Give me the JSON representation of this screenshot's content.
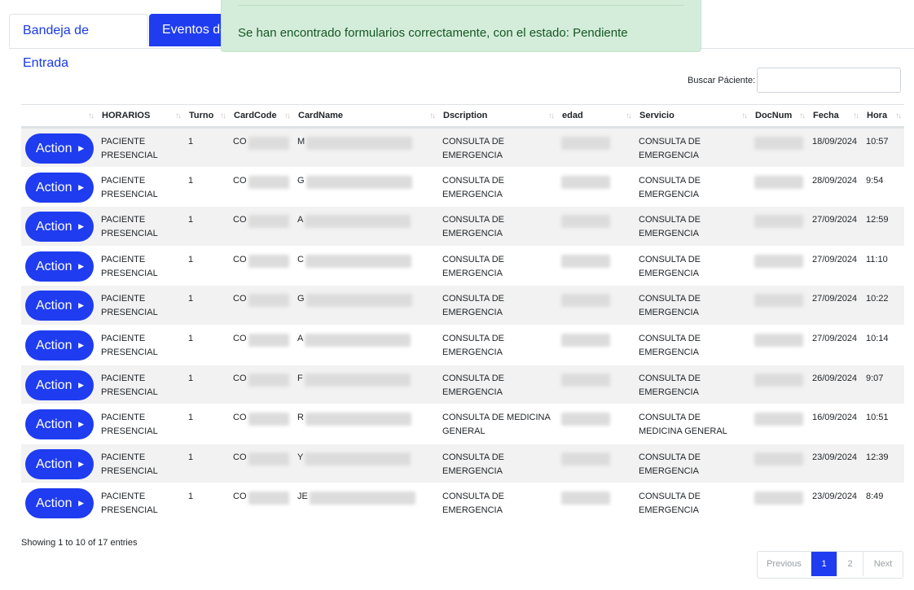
{
  "tabs": {
    "inbox": "Bandeja de Entrada",
    "events": "Eventos de"
  },
  "toast": {
    "message": "Se han encontrado formularios correctamente, con el estado: Pendiente"
  },
  "search": {
    "label": "Buscar Páciente:",
    "value": ""
  },
  "table": {
    "headers": [
      "",
      "HORARIOS",
      "Turno",
      "CardCode",
      "CardName",
      "Dscription",
      "edad",
      "Servicio",
      "DocNum",
      "Fecha",
      "Hora"
    ],
    "action_label": "Action",
    "rows": [
      {
        "horarios": "PACIENTE PRESENCIAL",
        "turno": "1",
        "cardcode": "CO",
        "cardname": "M",
        "dscription": "CONSULTA DE EMERGENCIA",
        "servicio": "CONSULTA DE EMERGENCIA",
        "fecha": "18/09/2024",
        "hora": "10:57"
      },
      {
        "horarios": "PACIENTE PRESENCIAL",
        "turno": "1",
        "cardcode": "CO",
        "cardname": "G",
        "dscription": "CONSULTA DE EMERGENCIA",
        "servicio": "CONSULTA DE EMERGENCIA",
        "fecha": "28/09/2024",
        "hora": "9:54"
      },
      {
        "horarios": "PACIENTE PRESENCIAL",
        "turno": "1",
        "cardcode": "CO",
        "cardname": "A",
        "dscription": "CONSULTA DE EMERGENCIA",
        "servicio": "CONSULTA DE EMERGENCIA",
        "fecha": "27/09/2024",
        "hora": "12:59"
      },
      {
        "horarios": "PACIENTE PRESENCIAL",
        "turno": "1",
        "cardcode": "CO",
        "cardname": "C",
        "dscription": "CONSULTA DE EMERGENCIA",
        "servicio": "CONSULTA DE EMERGENCIA",
        "fecha": "27/09/2024",
        "hora": "11:10"
      },
      {
        "horarios": "PACIENTE PRESENCIAL",
        "turno": "1",
        "cardcode": "CO",
        "cardname": "G",
        "dscription": "CONSULTA DE EMERGENCIA",
        "servicio": "CONSULTA DE EMERGENCIA",
        "fecha": "27/09/2024",
        "hora": "10:22"
      },
      {
        "horarios": "PACIENTE PRESENCIAL",
        "turno": "1",
        "cardcode": "CO",
        "cardname": "A",
        "dscription": "CONSULTA DE EMERGENCIA",
        "servicio": "CONSULTA DE EMERGENCIA",
        "fecha": "27/09/2024",
        "hora": "10:14"
      },
      {
        "horarios": "PACIENTE PRESENCIAL",
        "turno": "1",
        "cardcode": "CO",
        "cardname": "F",
        "dscription": "CONSULTA DE EMERGENCIA",
        "servicio": "CONSULTA DE EMERGENCIA",
        "fecha": "26/09/2024",
        "hora": "9:07"
      },
      {
        "horarios": "PACIENTE PRESENCIAL",
        "turno": "1",
        "cardcode": "CO",
        "cardname": "R",
        "dscription": "CONSULTA DE MEDICINA GENERAL",
        "servicio": "CONSULTA DE MEDICINA GENERAL",
        "fecha": "16/09/2024",
        "hora": "10:51"
      },
      {
        "horarios": "PACIENTE PRESENCIAL",
        "turno": "1",
        "cardcode": "CO",
        "cardname": "Y",
        "dscription": "CONSULTA DE EMERGENCIA",
        "servicio": "CONSULTA DE EMERGENCIA",
        "fecha": "23/09/2024",
        "hora": "12:39"
      },
      {
        "horarios": "PACIENTE PRESENCIAL",
        "turno": "1",
        "cardcode": "CO",
        "cardname": "JE",
        "dscription": "CONSULTA DE EMERGENCIA",
        "servicio": "CONSULTA DE EMERGENCIA",
        "fecha": "23/09/2024",
        "hora": "8:49"
      }
    ]
  },
  "footer": {
    "info": "Showing 1 to 10 of 17 entries",
    "previous": "Previous",
    "page1": "1",
    "page2": "2",
    "next": "Next"
  },
  "colors": {
    "primary": "#1f3cf0",
    "toast_bg": "#d4edda",
    "toast_text": "#155724",
    "row_stripe": "#f2f2f2"
  },
  "icons": {
    "sort": "sort-arrows-icon",
    "action_caret": "caret-right-icon"
  }
}
